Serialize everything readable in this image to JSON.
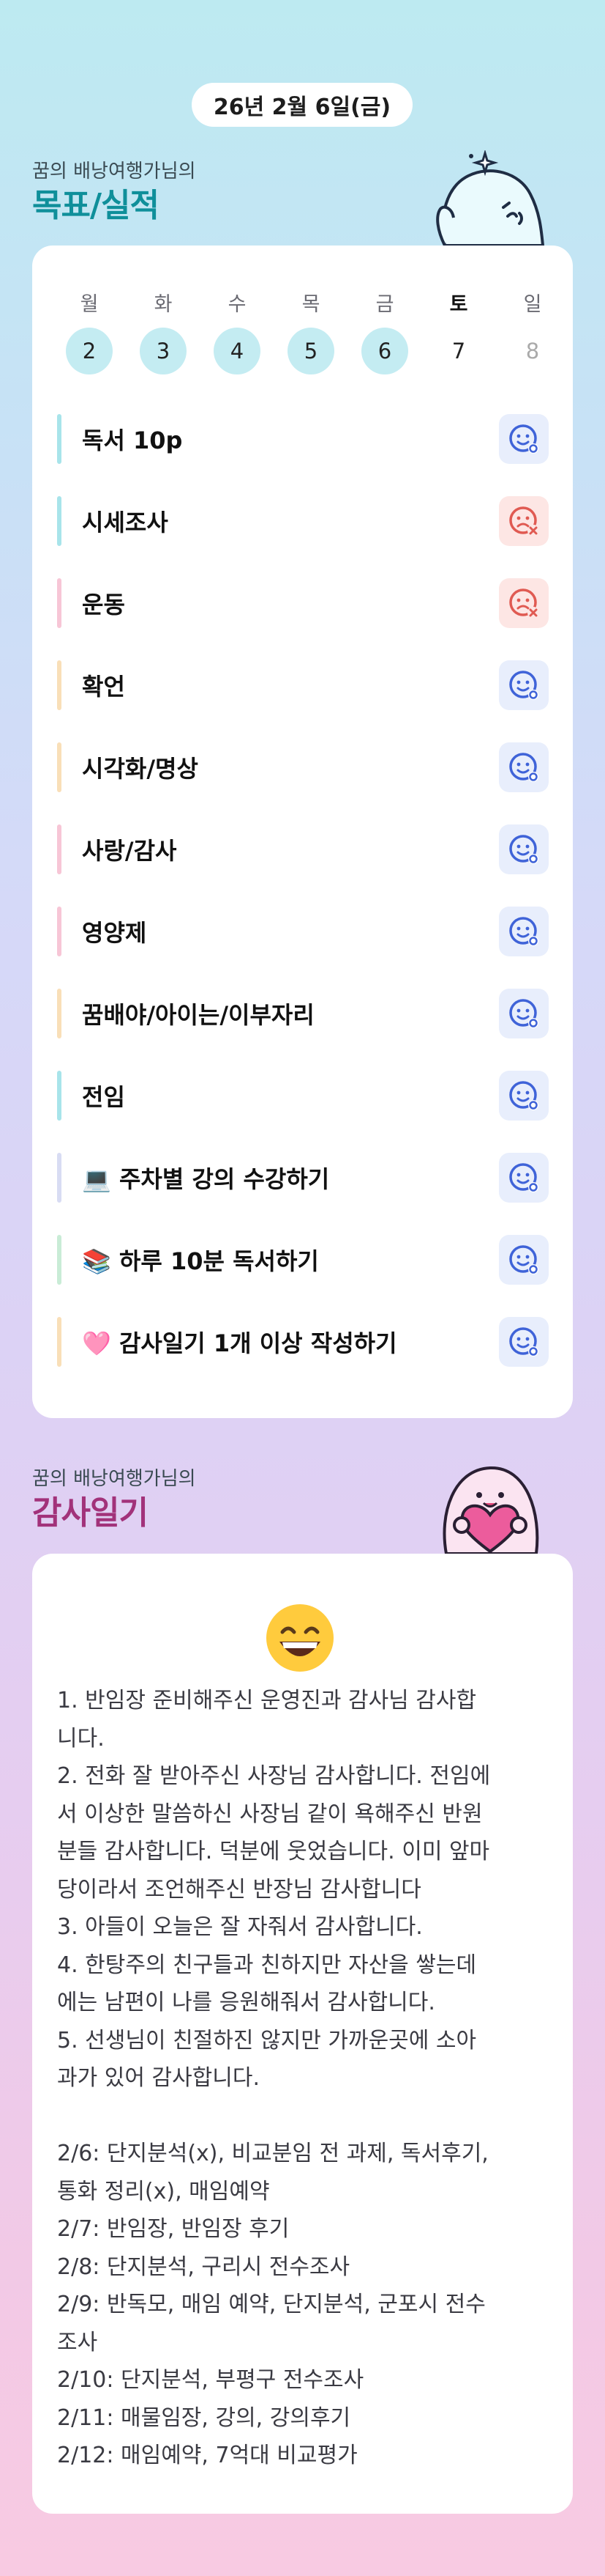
{
  "header": {
    "date": "26년 2월 6일(금)"
  },
  "goals_section": {
    "subtitle": "꿈의 배낭여행가님의",
    "title": "목표/실적",
    "week": [
      {
        "label": "월",
        "num": "2",
        "done": true
      },
      {
        "label": "화",
        "num": "3",
        "done": true
      },
      {
        "label": "수",
        "num": "4",
        "done": true
      },
      {
        "label": "목",
        "num": "5",
        "done": true
      },
      {
        "label": "금",
        "num": "6",
        "done": true
      },
      {
        "label": "토",
        "num": "7",
        "done": false
      },
      {
        "label": "일",
        "num": "8",
        "done": false
      }
    ],
    "goals": [
      {
        "label": "독서 10p",
        "status": "success",
        "bar_color": "#a8e4ea"
      },
      {
        "label": "시세조사",
        "status": "fail",
        "bar_color": "#a8e4ea"
      },
      {
        "label": "운동",
        "status": "fail",
        "bar_color": "#f7c6d6"
      },
      {
        "label": "확언",
        "status": "success",
        "bar_color": "#f9dfb8"
      },
      {
        "label": "시각화/명상",
        "status": "success",
        "bar_color": "#f9dfb8"
      },
      {
        "label": "사랑/감사",
        "status": "success",
        "bar_color": "#f7c6d6"
      },
      {
        "label": "영양제",
        "status": "success",
        "bar_color": "#f7c6d6"
      },
      {
        "label": "꿈배야/아이는/이부자리",
        "status": "success",
        "bar_color": "#f9dfb8"
      },
      {
        "label": "전임",
        "status": "success",
        "bar_color": "#a8e4ea"
      },
      {
        "label": "💻 주차별 강의 수강하기",
        "status": "success",
        "bar_color": "#d8dcf3"
      },
      {
        "label": "📚 하루 10분 독서하기",
        "status": "success",
        "bar_color": "#c9ecd6"
      },
      {
        "label": "🩷 감사일기 1개 이상 작성하기",
        "status": "success",
        "bar_color": "#f9dfb8"
      }
    ]
  },
  "gratitude_section": {
    "subtitle": "꿈의 배낭여행가님의",
    "title": "감사일기",
    "mood_icon": "grinning-face-emoji",
    "text": "1. 반임장 준비해주신 운영진과 감사님 감사합\n니다.\n2. 전화 잘 받아주신 사장님 감사합니다. 전임에\n서 이상한 말씀하신 사장님 같이 욕해주신 반원\n분들 감사합니다. 덕분에 웃었습니다. 이미 앞마\n당이라서 조언해주신 반장님 감사합니다\n3. 아들이 오늘은 잘 자줘서 감사합니다.\n4. 한탕주의 친구들과 친하지만 자산을 쌓는데\n에는 남편이 나를 응원해줘서 감사합니다.\n5. 선생님이 친절하진 않지만 가까운곳에 소아\n과가 있어 감사합니다.\n\n2/6: 단지분석(x), 비교분임 전 과제, 독서후기,\n통화 정리(x), 매임예약\n2/7: 반임장, 반임장 후기\n2/8: 단지분석, 구리시 전수조사\n2/9: 반독모, 매임 예약, 단지분석, 군포시 전수\n조사\n2/10: 단지분석, 부평구 전수조사\n2/11: 매물임장, 강의, 강의후기\n2/12: 매임예약, 7억대 비교평가"
  },
  "colors": {
    "success_icon": "#3f63d8",
    "fail_icon": "#e05a52",
    "goals_title": "#0f8f9a",
    "gratitude_title": "#a2327a"
  }
}
